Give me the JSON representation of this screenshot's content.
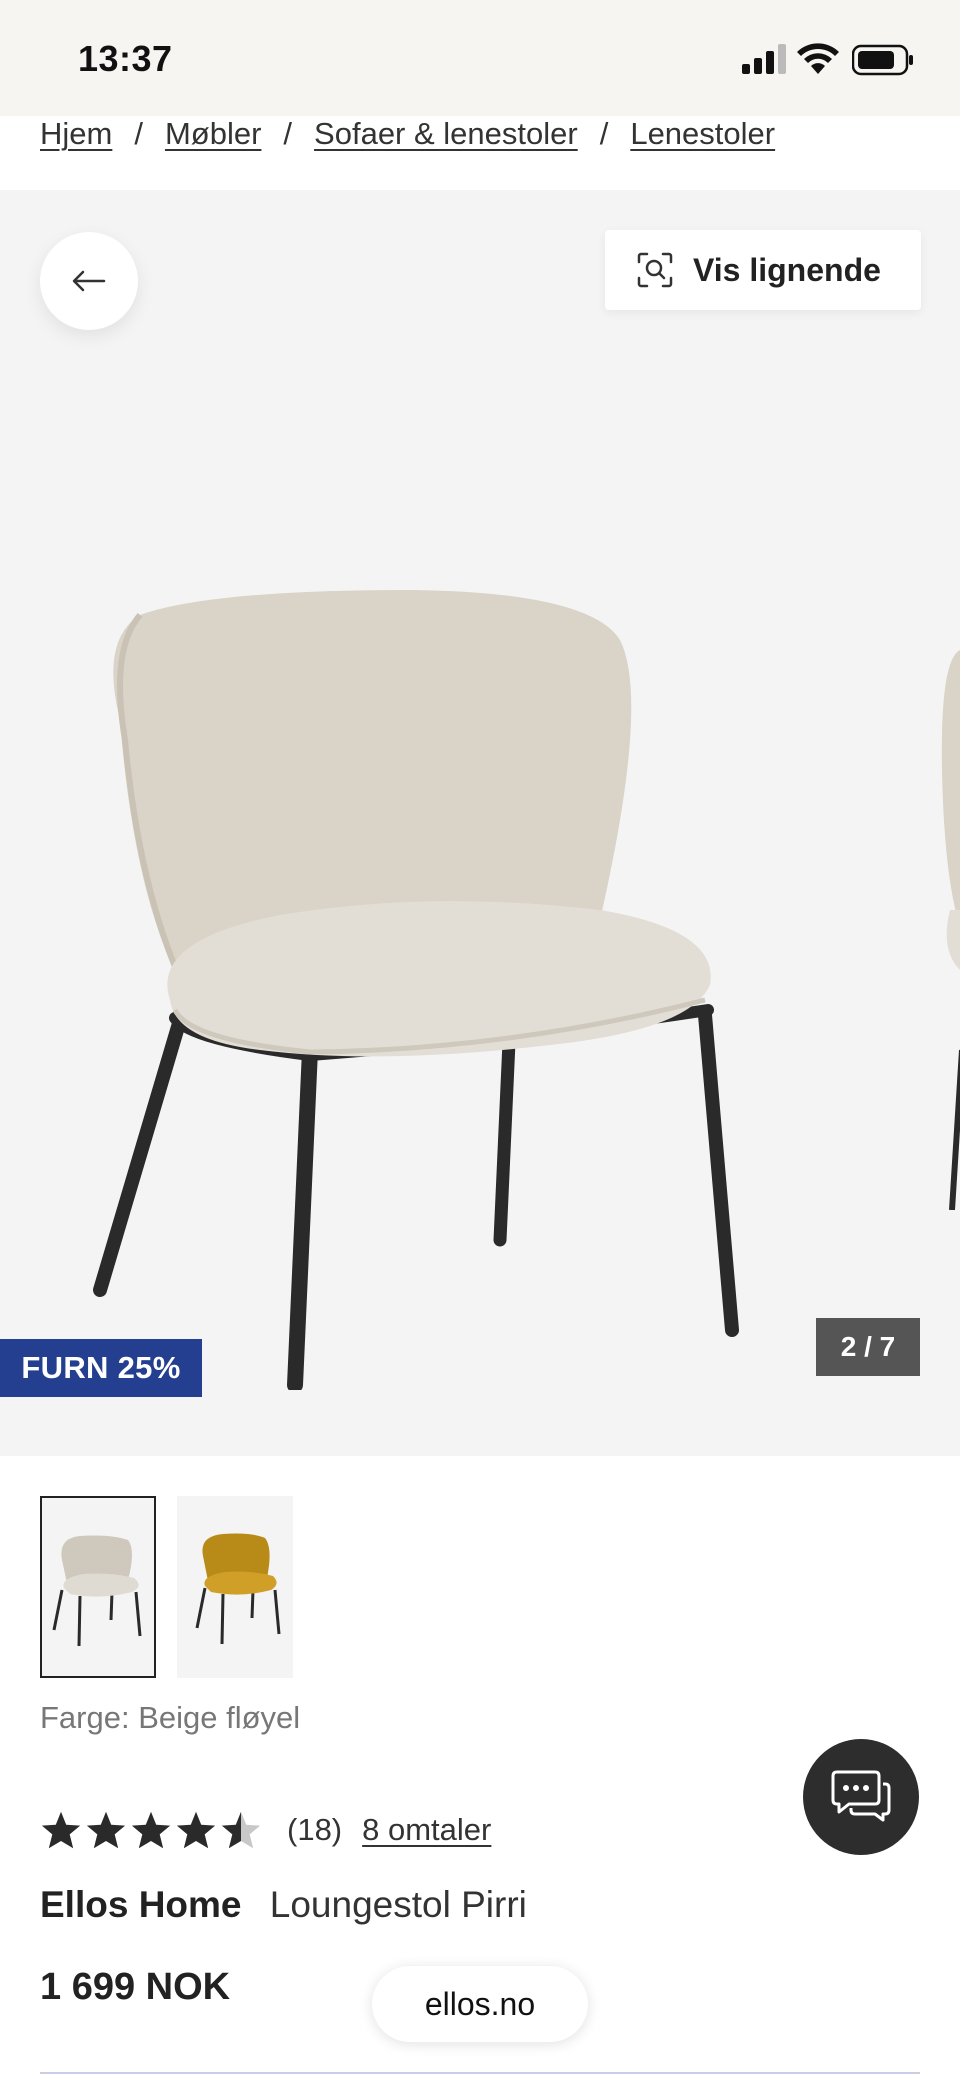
{
  "status_bar": {
    "time": "13:37"
  },
  "breadcrumb": {
    "items": [
      "Hjem",
      "Møbler",
      "Sofaer & lenestoler",
      "Lenestoler"
    ],
    "separator": "/"
  },
  "gallery": {
    "similar_label": "Vis lignende",
    "promo": "FURN 25%",
    "counter": "2 / 7"
  },
  "thumbnails": [
    {
      "name": "beige",
      "color": "#d9d3c8",
      "selected": true
    },
    {
      "name": "yellow",
      "color": "#c9961f",
      "selected": false
    }
  ],
  "product": {
    "color_label": "Farge: Beige fløyel",
    "rating": 4.5,
    "rating_count": "(18)",
    "reviews_link": "8 omtaler",
    "brand": "Ellos Home",
    "name": "Loungestol Pirri",
    "price": "1 699 NOK"
  },
  "browser": {
    "url": "ellos.no"
  },
  "colors": {
    "promo_bg": "#243f8f",
    "chat_bg": "#2d2d2d",
    "counter_bg": "#555555"
  }
}
